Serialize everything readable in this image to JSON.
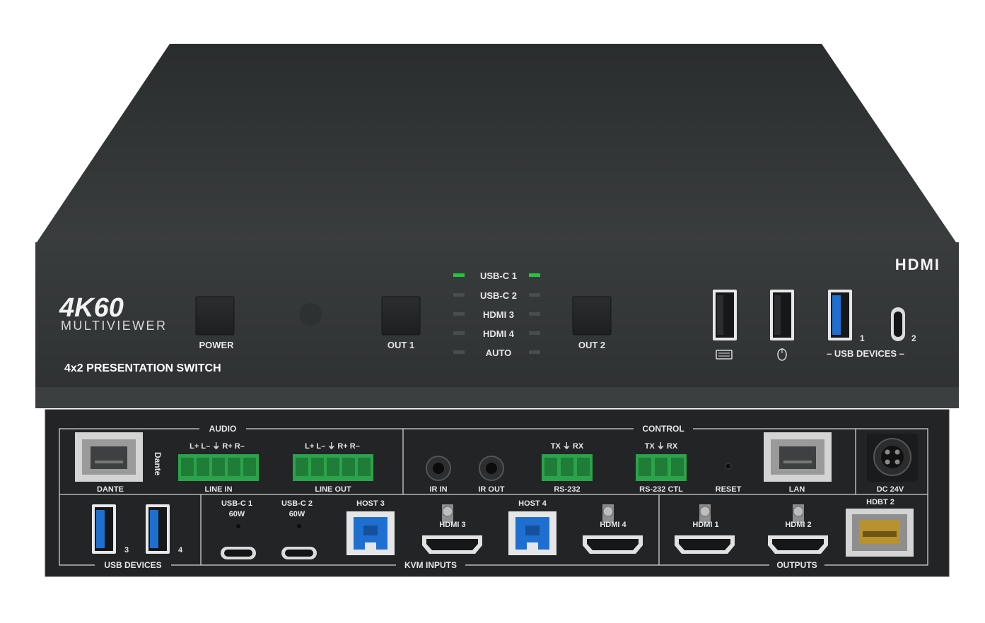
{
  "front": {
    "brand_big": "4K60",
    "brand_small": "MULTIVIEWER",
    "product": "4x2 PRESENTATION SWITCH",
    "hdmi_logo": "HDMI",
    "power_label": "POWER",
    "out1_label": "OUT 1",
    "out2_label": "OUT 2",
    "leds": [
      {
        "label": "USB-C 1",
        "active": true
      },
      {
        "label": "USB-C 2",
        "active": false
      },
      {
        "label": "HDMI 3",
        "active": false
      },
      {
        "label": "HDMI 4",
        "active": false
      },
      {
        "label": "AUTO",
        "active": false
      }
    ],
    "usb_num_1": "1",
    "usb_num_2": "2",
    "usb_devices_label": "– USB DEVICES –",
    "keyboard_icon": "keyboard-icon",
    "mouse_icon": "mouse-icon"
  },
  "rear": {
    "audio_label": "AUDIO",
    "control_label": "CONTROL",
    "dante_label": "DANTE",
    "dante_logo": "Dante",
    "line_in_label": "LINE IN",
    "line_out_label": "LINE OUT",
    "line_in_pins": "L+ L– ⏚ R+ R–",
    "line_out_pins": "L+ L– ⏚ R+ R–",
    "ir_in_label": "IR IN",
    "ir_out_label": "IR OUT",
    "rs232_pins": "TX ⏚ RX",
    "rs232_label": "RS-232",
    "rs232ctl_pins": "TX ⏚ RX",
    "rs232ctl_label": "RS-232 CTL",
    "reset_label": "RESET",
    "lan_label": "LAN",
    "dc_label": "DC 24V",
    "usb_devices_label": "USB DEVICES",
    "usb_num_3": "3",
    "usb_num_4": "4",
    "usbc1_label": "USB-C 1",
    "usbc1_power": "60W",
    "usbc2_label": "USB-C 2",
    "usbc2_power": "60W",
    "host3_label": "HOST 3",
    "host4_label": "HOST 4",
    "hdmi3_label": "HDMI 3",
    "hdmi4_label": "HDMI 4",
    "hdmi1_label": "HDMI 1",
    "hdmi2_label": "HDMI 2",
    "hdbt2_label": "HDBT 2",
    "kvm_inputs_label": "KVM INPUTS",
    "outputs_label": "OUTPUTS"
  },
  "colors": {
    "chassis_top": "#2f3233",
    "front_panel": "#343738",
    "rear_panel": "#222426",
    "led_green": "#23c63a",
    "led_off": "#4a4d4f",
    "usb3_blue": "#1f6fd1",
    "terminal_green": "#2aa34a",
    "hdbt_gold": "#b8922f"
  }
}
